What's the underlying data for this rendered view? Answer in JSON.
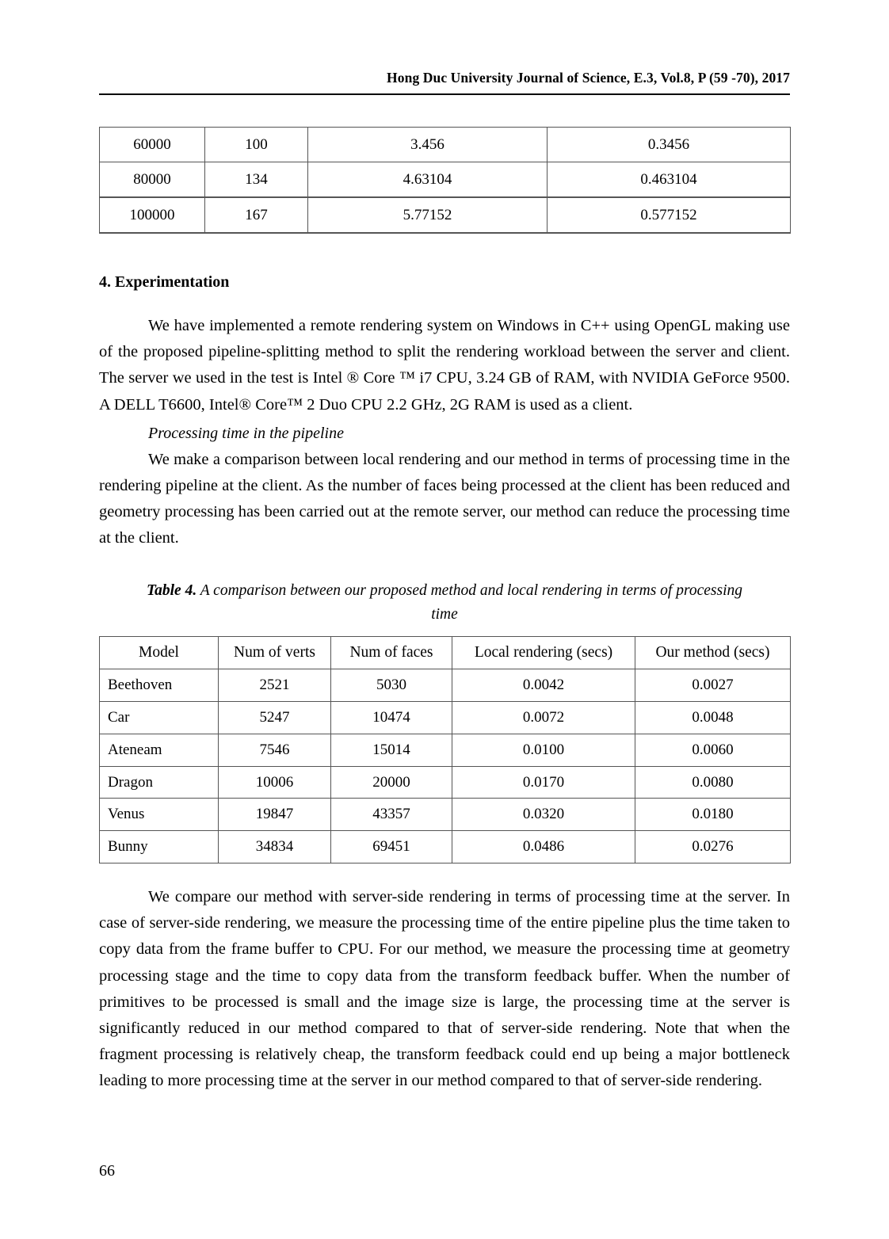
{
  "running_head": "Hong Duc University Journal of Science, E.3, Vol.8, P (59 -70), 2017",
  "folio": "66",
  "continued_table": {
    "rows": [
      [
        "60000",
        "100",
        "3.456",
        "0.3456"
      ],
      [
        "80000",
        "134",
        "4.63104",
        "0.463104"
      ],
      [
        "100000",
        "167",
        "5.77152",
        "0.577152"
      ]
    ]
  },
  "section": {
    "heading": "4. Experimentation",
    "paragraph_1": "We have implemented a remote rendering system on Windows in C++ using OpenGL making use of the proposed pipeline-splitting method to split the rendering workload between the server and client. The server we used in the test is Intel ® Core ™ i7 CPU, 3.24 GB of RAM, with NVIDIA GeForce 9500. A DELL T6600, Intel® Core™ 2 Duo CPU 2.2 GHz, 2G RAM is used as a client.",
    "subheading": "Processing time in the pipeline",
    "paragraph_2": "We make a comparison between local rendering and our method in terms of processing time in the rendering pipeline at the client. As the number of faces being processed at the client has been reduced and geometry processing has been carried out at the remote server, our method can reduce the processing time at the client.",
    "paragraph_3": "We compare our method with server-side rendering in terms of processing time at the server. In case of server-side rendering, we measure the processing time of the entire pipeline plus the time taken to copy data from the frame buffer to CPU. For our method, we measure the processing time at geometry processing stage and the time to copy data from the transform feedback buffer. When the number of primitives to be processed is small and the image size is large, the processing time at the server is significantly reduced in our method compared to that of server-side rendering. Note that when the fragment processing is relatively cheap, the transform feedback could end up being a major bottleneck leading to more processing time at the server in our method compared to that of server-side rendering."
  },
  "table4": {
    "caption_label": "Table 4.",
    "caption_text": " A comparison between our proposed method and local rendering in terms of processing time",
    "headers": [
      "Model",
      "Num of verts",
      "Num of faces",
      "Local rendering (secs)",
      "Our method (secs)"
    ],
    "rows": [
      [
        "Beethoven",
        "2521",
        "5030",
        "0.0042",
        "0.0027"
      ],
      [
        "Car",
        "5247",
        "10474",
        "0.0072",
        "0.0048"
      ],
      [
        "Ateneam",
        "7546",
        "15014",
        "0.0100",
        "0.0060"
      ],
      [
        "Dragon",
        "10006",
        "20000",
        "0.0170",
        "0.0080"
      ],
      [
        "Venus",
        "19847",
        "43357",
        "0.0320",
        "0.0180"
      ],
      [
        "Bunny",
        "34834",
        "69451",
        "0.0486",
        "0.0276"
      ]
    ]
  }
}
